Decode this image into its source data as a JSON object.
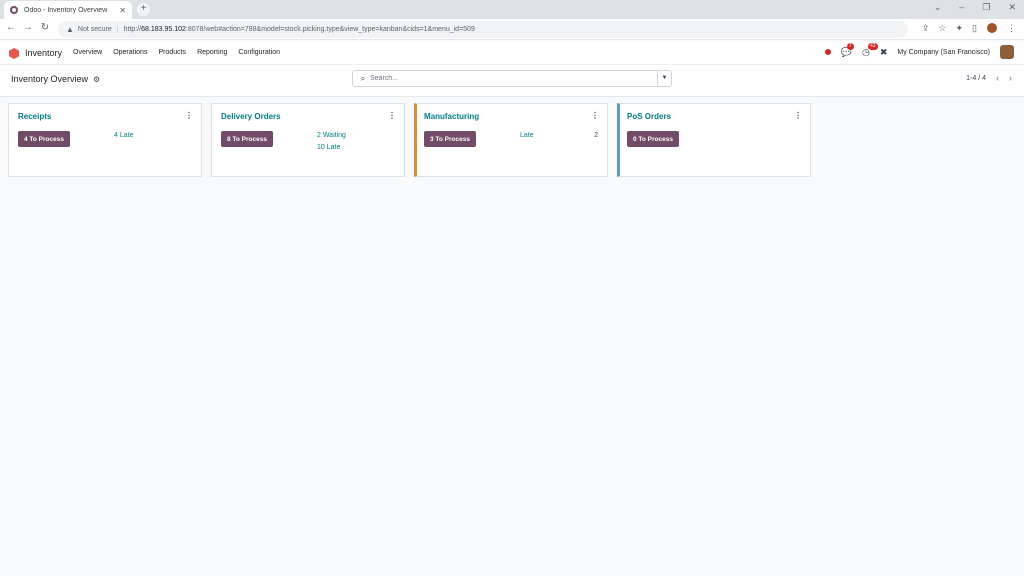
{
  "browser": {
    "tab_title": "Odoo - Inventory Overview",
    "tab_close": "✕",
    "new_tab": "+",
    "security_label": "Not secure",
    "url_host": "68.183.95.102",
    "url_rest": ":8078/web#action=788&model=stock.picking.type&view_type=kanban&cids=1&menu_id=509",
    "url_scheme": "http://"
  },
  "navbar": {
    "app_name": "Inventory",
    "menu": [
      "Overview",
      "Operations",
      "Products",
      "Reporting",
      "Configuration"
    ],
    "messages_badge": "7",
    "activities_badge": "43",
    "company": "My Company (San Francisco)"
  },
  "control": {
    "breadcrumb": "Inventory Overview",
    "search_placeholder": "Search...",
    "pager": "1-4 / 4"
  },
  "cards": [
    {
      "title": "Receipts",
      "button": "4 To Process",
      "links": [
        "4 Late"
      ],
      "number": ""
    },
    {
      "title": "Delivery Orders",
      "button": "8 To Process",
      "links": [
        "2 Waiting",
        "10 Late"
      ],
      "number": ""
    },
    {
      "title": "Manufacturing",
      "button": "3 To Process",
      "links": [
        "Late"
      ],
      "number": "2"
    },
    {
      "title": "PoS Orders",
      "button": "0 To Process",
      "links": [],
      "number": ""
    }
  ],
  "colors": {
    "brand": "#714b67",
    "link": "#017e84",
    "manufacturing_accent": "#e08a3c",
    "pos_accent": "#5b9bd5"
  }
}
